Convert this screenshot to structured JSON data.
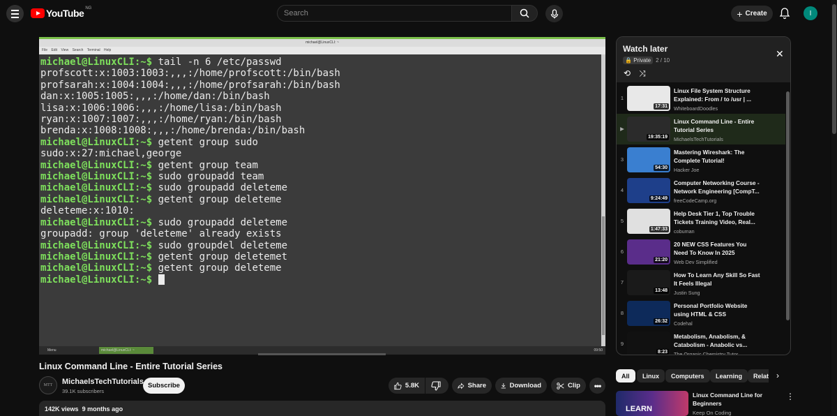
{
  "topbar": {
    "logo_text": "YouTube",
    "country": "NG",
    "search_placeholder": "Search",
    "create_label": "Create",
    "avatar_letter": "I"
  },
  "player": {
    "vm_window_title": "michael@LinuxCLI: ~",
    "vm_menu": "File Edit View Search Terminal Help",
    "terminal_lines": [
      {
        "prompt": "michael@LinuxCLI:~$",
        "text": " tail -n 6 /etc/passwd"
      },
      {
        "prompt": "",
        "text": "profscott:x:1003:1003:,,,:/home/profscott:/bin/bash"
      },
      {
        "prompt": "",
        "text": "profsarah:x:1004:1004:,,,:/home/profsarah:/bin/bash"
      },
      {
        "prompt": "",
        "text": "dan:x:1005:1005:,,,:/home/dan:/bin/bash"
      },
      {
        "prompt": "",
        "text": "lisa:x:1006:1006:,,,:/home/lisa:/bin/bash"
      },
      {
        "prompt": "",
        "text": "ryan:x:1007:1007:,,,:/home/ryan:/bin/bash"
      },
      {
        "prompt": "",
        "text": "brenda:x:1008:1008:,,,:/home/brenda:/bin/bash"
      },
      {
        "prompt": "michael@LinuxCLI:~$",
        "text": " getent group sudo"
      },
      {
        "prompt": "",
        "text": "sudo:x:27:michael,george"
      },
      {
        "prompt": "michael@LinuxCLI:~$",
        "text": " getent group team"
      },
      {
        "prompt": "michael@LinuxCLI:~$",
        "text": " sudo groupadd team"
      },
      {
        "prompt": "michael@LinuxCLI:~$",
        "text": " sudo groupadd deleteme"
      },
      {
        "prompt": "michael@LinuxCLI:~$",
        "text": " getent group deleteme"
      },
      {
        "prompt": "",
        "text": "deleteme:x:1010:"
      },
      {
        "prompt": "michael@LinuxCLI:~$",
        "text": " sudo groupadd deleteme"
      },
      {
        "prompt": "",
        "text": "groupadd: group 'deleteme' already exists"
      },
      {
        "prompt": "michael@LinuxCLI:~$",
        "text": " sudo groupdel deleteme"
      },
      {
        "prompt": "michael@LinuxCLI:~$",
        "text": " getent group deletemet"
      },
      {
        "prompt": "michael@LinuxCLI:~$",
        "text": " getent group deleteme"
      },
      {
        "prompt": "michael@LinuxCLI:~$",
        "text": " "
      }
    ],
    "taskbar_menu": "Menu",
    "taskbar_task": "michael@LinuxCLI: ~",
    "taskbar_clock": "09:50"
  },
  "video": {
    "title": "Linux Command Line - Entire Tutorial Series",
    "channel": "MichaelsTechTutorials",
    "channel_avatar": "MTT",
    "subscribers": "39.1K subscribers",
    "subscribe_label": "Subscribe",
    "likes": "5.8K",
    "share_label": "Share",
    "download_label": "Download",
    "clip_label": "Clip",
    "views": "142K views",
    "age": "9 months ago"
  },
  "watch_later": {
    "title": "Watch later",
    "privacy": "Private",
    "position": "2 / 10",
    "items": [
      {
        "index": "1",
        "title": "Linux File System Structure Explained: From / to /usr | ...",
        "channel": "WhiteboardDoodles",
        "duration": "17:31",
        "thumb_color": "#e8e8e8"
      },
      {
        "index": "▶",
        "title": "Linux Command Line - Entire Tutorial Series",
        "channel": "MichaelsTechTutorials",
        "duration": "19:35:19",
        "thumb_color": "#2b2b2b"
      },
      {
        "index": "3",
        "title": "Mastering Wireshark: The Complete Tutorial!",
        "channel": "Hacker Joe",
        "duration": "54:30",
        "thumb_color": "#3a7fd0"
      },
      {
        "index": "4",
        "title": "Computer Networking Course - Network Engineering [CompT...",
        "channel": "freeCodeCamp.org",
        "duration": "9:24:49",
        "thumb_color": "#1e3f8a"
      },
      {
        "index": "5",
        "title": "Help Desk Tier 1, Top Trouble Tickets Training Video, Real...",
        "channel": "cobuman",
        "duration": "1:47:33",
        "thumb_color": "#e0e0e0"
      },
      {
        "index": "6",
        "title": "20 NEW CSS Features You Need To Know In 2025",
        "channel": "Web Dev Simplified",
        "duration": "21:20",
        "thumb_color": "#5a2d8a"
      },
      {
        "index": "7",
        "title": "How To Learn Any Skill So Fast It Feels Illegal",
        "channel": "Justin Sung",
        "duration": "13:48",
        "thumb_color": "#1a1a1a"
      },
      {
        "index": "8",
        "title": "Personal Portfolio Website using HTML & CSS",
        "channel": "Codehal",
        "duration": "26:32",
        "thumb_color": "#0d2a5a"
      },
      {
        "index": "9",
        "title": "Metabolism, Anabolism, & Catabolism - Anabolic vs...",
        "channel": "The Organic Chemistry Tutor",
        "duration": "8:23",
        "thumb_color": "#111111"
      }
    ]
  },
  "chips": [
    "All",
    "Linux",
    "Computers",
    "Learning",
    "Relat"
  ],
  "recommendation": {
    "title": "Linux Command Line for Beginners",
    "channel": "Keep On Coding",
    "thumb_text": "LEARN"
  }
}
